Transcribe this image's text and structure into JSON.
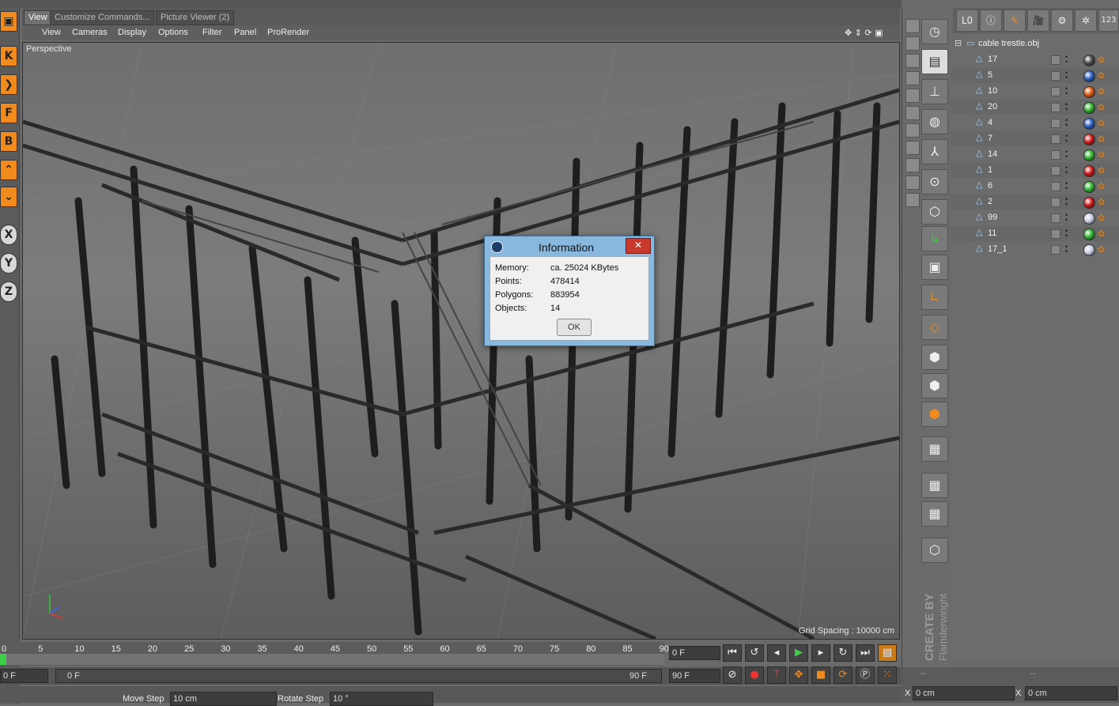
{
  "tabs": [
    "View",
    "Customize Commands...",
    "Picture Viewer (2)"
  ],
  "menu": [
    "View",
    "Cameras",
    "Display",
    "Options",
    "Filter",
    "Panel",
    "ProRender"
  ],
  "viewport": {
    "label": "Perspective",
    "grid_spacing": "Grid Spacing : 10000 cm"
  },
  "left_toolbar": [
    {
      "icon": "cube-icon",
      "glyph": "▣"
    },
    {
      "icon": "arrow-left-icon",
      "glyph": "K"
    },
    {
      "icon": "arrow-right-icon",
      "glyph": "❯"
    },
    {
      "icon": "f-icon",
      "glyph": "F"
    },
    {
      "icon": "b-icon",
      "glyph": "B"
    },
    {
      "icon": "caret-up-icon",
      "glyph": "⌃"
    },
    {
      "icon": "caret-down-icon",
      "glyph": "⌄"
    },
    {
      "icon": "x-axis-icon",
      "glyph": "X"
    },
    {
      "icon": "y-axis-icon",
      "glyph": "Y"
    },
    {
      "icon": "z-axis-icon",
      "glyph": "Z"
    }
  ],
  "dialog": {
    "title": "Information",
    "close": "✕",
    "rows": [
      {
        "label": "Memory:",
        "value": "ca. 25024 KBytes"
      },
      {
        "label": "Points:",
        "value": "478414"
      },
      {
        "label": "Polygons:",
        "value": "883954"
      },
      {
        "label": "Objects:",
        "value": "14"
      }
    ],
    "ok": "OK"
  },
  "timeline": {
    "ticks": [
      "0",
      "5",
      "10",
      "15",
      "20",
      "25",
      "30",
      "35",
      "40",
      "45",
      "50",
      "55",
      "60",
      "65",
      "70",
      "75",
      "80",
      "85",
      "90"
    ],
    "current_frame": "0 F",
    "start": "0 F",
    "range_start": "0 F",
    "range_end": "90 F",
    "end": "90 F"
  },
  "controls": {
    "move_step_label": "Move Step",
    "move_step_value": "10 cm",
    "rotate_step_label": "Rotate Step",
    "rotate_step_value": "10 °"
  },
  "object_manager": {
    "root": "cable trestle.obj",
    "objects": [
      {
        "name": "17",
        "color": "#4a4a4a"
      },
      {
        "name": "5",
        "color": "#2a5fc2"
      },
      {
        "name": "10",
        "color": "#e05a10"
      },
      {
        "name": "20",
        "color": "#2fb52f"
      },
      {
        "name": "4",
        "color": "#2a5fc2"
      },
      {
        "name": "7",
        "color": "#d01818"
      },
      {
        "name": "14",
        "color": "#2fb52f"
      },
      {
        "name": "1",
        "color": "#d01818"
      },
      {
        "name": "6",
        "color": "#2fb52f"
      },
      {
        "name": "2",
        "color": "#d01818"
      },
      {
        "name": "99",
        "color": "#c9cde8"
      },
      {
        "name": "11",
        "color": "#2fb52f"
      },
      {
        "name": "17_1",
        "color": "#c9cde8"
      }
    ]
  },
  "credit": {
    "line1": "CREATE BY",
    "line2": "Flamderwinght"
  },
  "coords": {
    "x_label": "X",
    "x_value": "0 cm",
    "x2_label": "X",
    "x2_value": "0 cm",
    "dashes": "--"
  }
}
